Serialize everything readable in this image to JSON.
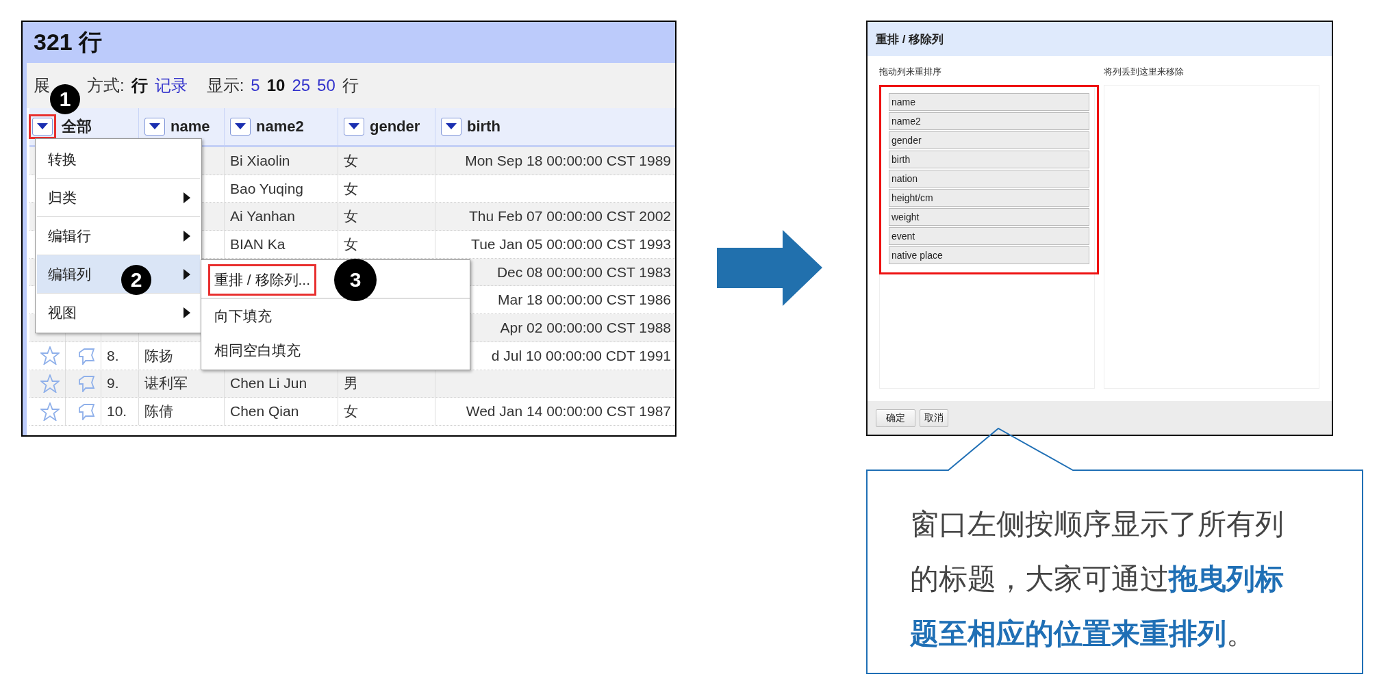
{
  "table_view": {
    "title": "321 行",
    "toolbar": {
      "label_parts": [
        "展",
        "方式:"
      ],
      "view_modes": [
        {
          "label": "行",
          "selected": true
        },
        {
          "label": "记录",
          "selected": false
        }
      ],
      "show_label": "显示:",
      "page_sizes": [
        {
          "label": "5",
          "selected": false
        },
        {
          "label": "10",
          "selected": true
        },
        {
          "label": "25",
          "selected": false
        },
        {
          "label": "50",
          "selected": false
        }
      ],
      "unit": "行"
    },
    "columns": [
      {
        "label": "全部",
        "highlighted": true,
        "step": "1"
      },
      {
        "label": "name",
        "highlighted": false
      },
      {
        "label": "name2",
        "highlighted": false
      },
      {
        "label": "gender",
        "highlighted": false
      },
      {
        "label": "birth",
        "highlighted": false
      }
    ],
    "rows": [
      {
        "name2": "Bi Xiaolin",
        "gender": "女",
        "birth": "Mon Sep 18 00:00:00 CST 1989"
      },
      {
        "name2": "Bao Yuqing",
        "gender": "女"
      },
      {
        "name2": "Ai Yanhan",
        "gender": "女",
        "birth": "Thu Feb 07 00:00:00 CST 2002"
      },
      {
        "name2": "BIAN Ka",
        "gender": "女",
        "birth": "Tue Jan 05 00:00:00 CST 1993"
      },
      {
        "birth": "Dec 08 00:00:00 CST 1983"
      },
      {
        "birth": "Mar 18 00:00:00 CST 1986"
      },
      {
        "birth": "Apr 02 00:00:00 CST 1988"
      },
      {
        "number": "8.",
        "name": "陈扬",
        "birth": "d Jul 10 00:00:00 CDT 1991"
      },
      {
        "number": "9.",
        "name": "谌利军",
        "name2": "Chen Li Jun",
        "gender": "男"
      },
      {
        "number": "10.",
        "name": "陈倩",
        "name2": "Chen Qian",
        "gender": "女",
        "birth": "Wed Jan 14 00:00:00 CST 1987"
      }
    ],
    "column_menu": [
      {
        "label": "转换",
        "has_submenu": false,
        "selected": false
      },
      {
        "label": "归类",
        "has_submenu": true,
        "selected": false
      },
      {
        "label": "编辑行",
        "has_submenu": true,
        "selected": false
      },
      {
        "label": "编辑列",
        "has_submenu": true,
        "selected": true,
        "step": "2"
      },
      {
        "label": "视图",
        "has_submenu": true,
        "selected": false
      }
    ],
    "submenu": [
      {
        "label": "重排 / 移除列...",
        "highlighted": true,
        "step": "3"
      },
      {
        "label": "向下填充",
        "highlighted": false
      },
      {
        "label": "相同空白填充",
        "highlighted": false
      }
    ]
  },
  "dialog": {
    "title": "重排 / 移除列",
    "left_label": "拖动列来重排序",
    "right_label": "将列丢到这里来移除",
    "list_highlighted": true,
    "columns": [
      "name",
      "name2",
      "gender",
      "birth",
      "nation",
      "height/cm",
      "weight",
      "event",
      "native place"
    ],
    "buttons": [
      "确定",
      "取消"
    ]
  },
  "callout": {
    "text": "窗口左侧按顺序显示了所有列的标题，大家可通过**拖曳列标题至相应的位置来重排列**。"
  }
}
